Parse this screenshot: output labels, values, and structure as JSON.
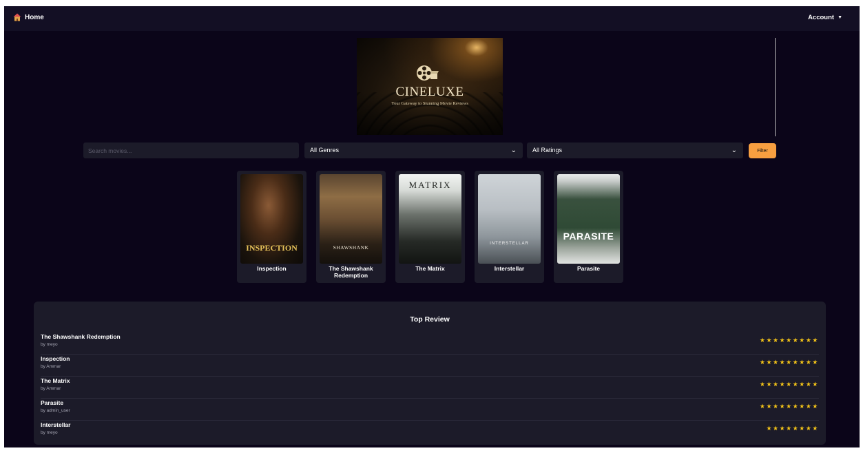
{
  "nav": {
    "home_label": "Home",
    "account_label": "Account"
  },
  "banner": {
    "title": "CINELUXE",
    "tagline": "Your Gateway to Stunning Movie Reviews"
  },
  "filters": {
    "search_placeholder": "Search movies...",
    "genre_selected": "All Genres",
    "rating_selected": "All Ratings",
    "filter_label": "Filter"
  },
  "movies": [
    {
      "title": "Inspection",
      "poster_text": "INSPECTION"
    },
    {
      "title": "The Shawshank Redemption",
      "poster_text": "SHAWSHANK"
    },
    {
      "title": "The Matrix",
      "poster_text": "MATRIX"
    },
    {
      "title": "Interstellar",
      "poster_text": "INTERSTELLAR"
    },
    {
      "title": "Parasite",
      "poster_text": "PARASITE"
    }
  ],
  "top_reviews": {
    "heading": "Top Review",
    "items": [
      {
        "title": "The Shawshank Redemption",
        "by": "by meyo",
        "stars": "★★★★★★★★★"
      },
      {
        "title": "Inspection",
        "by": "by Ammar",
        "stars": "★★★★★★★★★"
      },
      {
        "title": "The Matrix",
        "by": "by Ammar",
        "stars": "★★★★★★★★★"
      },
      {
        "title": "Parasite",
        "by": "by admin_user",
        "stars": "★★★★★★★★★"
      },
      {
        "title": "Interstellar",
        "by": "by meyo",
        "stars": "★★★★★★★★"
      }
    ]
  },
  "colors": {
    "background": "#0b0519",
    "navbar": "#130f24",
    "panel": "#1c1b29",
    "accent": "#f79f40",
    "star": "#f5c518"
  },
  "icons": {
    "home": "house-icon",
    "account_caret": "caret-down-icon",
    "select_caret": "chevron-down-icon",
    "banner_logo": "film-reel-icon"
  }
}
